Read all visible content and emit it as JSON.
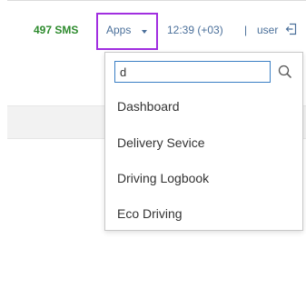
{
  "topbar": {
    "sms_label": "497 SMS",
    "apps_label": "Apps",
    "clock": "12:39 (+03)",
    "separator": "|",
    "user": "user"
  },
  "apps_menu": {
    "search": {
      "value": "d",
      "placeholder": ""
    },
    "items": [
      {
        "label": "Dashboard"
      },
      {
        "label": "Delivery Sevice"
      },
      {
        "label": "Driving Logbook"
      },
      {
        "label": "Eco Driving"
      }
    ]
  },
  "colors": {
    "sms_green": "#2e8b2e",
    "link_blue": "#4a6f9a",
    "highlight_purple": "#a12ee0",
    "input_border": "#3a7fc4"
  },
  "icons": {
    "caret": "caret-down-icon",
    "logout": "logout-icon",
    "search": "search-icon"
  }
}
